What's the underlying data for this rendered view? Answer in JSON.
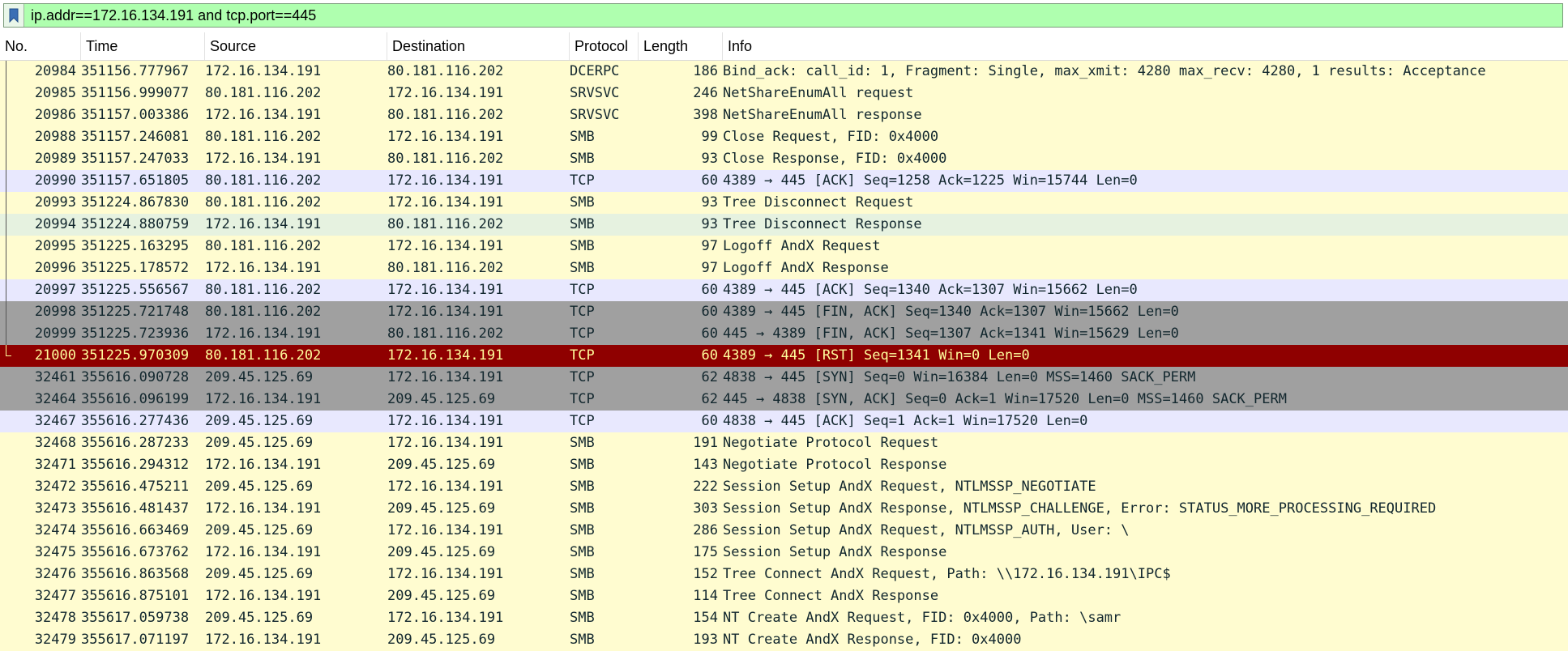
{
  "filter": {
    "value": "ip.addr==172.16.134.191 and tcp.port==445",
    "bookmark_icon": "bookmark-icon"
  },
  "columns": [
    {
      "label": "No."
    },
    {
      "label": "Time"
    },
    {
      "label": "Source"
    },
    {
      "label": "Destination"
    },
    {
      "label": "Protocol"
    },
    {
      "label": "Length"
    },
    {
      "label": "Info"
    }
  ],
  "colors": {
    "filter_bg": "#afffaf",
    "smb_row": "#fffcd0",
    "tcp_row": "#e8e8fe",
    "tcp_flag_row": "#a0a0a0",
    "selected_row": "#8f0000",
    "selected_text": "#fffc9c"
  },
  "packets": [
    {
      "no": "20984",
      "time": "351156.777967",
      "src": "172.16.134.191",
      "dst": "80.181.116.202",
      "proto": "DCERPC",
      "len": "186",
      "info": "Bind_ack: call_id: 1, Fragment: Single, max_xmit: 4280 max_recv: 4280, 1 results: Acceptance",
      "style": "smb",
      "tree": "line"
    },
    {
      "no": "20985",
      "time": "351156.999077",
      "src": "80.181.116.202",
      "dst": "172.16.134.191",
      "proto": "SRVSVC",
      "len": "246",
      "info": "NetShareEnumAll request",
      "style": "smb",
      "tree": "line"
    },
    {
      "no": "20986",
      "time": "351157.003386",
      "src": "172.16.134.191",
      "dst": "80.181.116.202",
      "proto": "SRVSVC",
      "len": "398",
      "info": "NetShareEnumAll response",
      "style": "smb",
      "tree": "line"
    },
    {
      "no": "20988",
      "time": "351157.246081",
      "src": "80.181.116.202",
      "dst": "172.16.134.191",
      "proto": "SMB",
      "len": "99",
      "info": "Close Request, FID: 0x4000",
      "style": "smb",
      "tree": "line"
    },
    {
      "no": "20989",
      "time": "351157.247033",
      "src": "172.16.134.191",
      "dst": "80.181.116.202",
      "proto": "SMB",
      "len": "93",
      "info": "Close Response, FID: 0x4000",
      "style": "smb",
      "tree": "line"
    },
    {
      "no": "20990",
      "time": "351157.651805",
      "src": "80.181.116.202",
      "dst": "172.16.134.191",
      "proto": "TCP",
      "len": "60",
      "info": "4389 → 445 [ACK] Seq=1258 Ack=1225 Win=15744 Len=0",
      "style": "tcp",
      "tree": "line"
    },
    {
      "no": "20993",
      "time": "351224.867830",
      "src": "80.181.116.202",
      "dst": "172.16.134.191",
      "proto": "SMB",
      "len": "93",
      "info": "Tree Disconnect Request",
      "style": "smb",
      "tree": "line"
    },
    {
      "no": "20994",
      "time": "351224.880759",
      "src": "172.16.134.191",
      "dst": "80.181.116.202",
      "proto": "SMB",
      "len": "93",
      "info": "Tree Disconnect Response",
      "style": "altgreen",
      "tree": "line"
    },
    {
      "no": "20995",
      "time": "351225.163295",
      "src": "80.181.116.202",
      "dst": "172.16.134.191",
      "proto": "SMB",
      "len": "97",
      "info": "Logoff AndX Request",
      "style": "smb",
      "tree": "line"
    },
    {
      "no": "20996",
      "time": "351225.178572",
      "src": "172.16.134.191",
      "dst": "80.181.116.202",
      "proto": "SMB",
      "len": "97",
      "info": "Logoff AndX Response",
      "style": "smb",
      "tree": "line"
    },
    {
      "no": "20997",
      "time": "351225.556567",
      "src": "80.181.116.202",
      "dst": "172.16.134.191",
      "proto": "TCP",
      "len": "60",
      "info": "4389 → 445 [ACK] Seq=1340 Ack=1307 Win=15662 Len=0",
      "style": "tcp",
      "tree": "line"
    },
    {
      "no": "20998",
      "time": "351225.721748",
      "src": "80.181.116.202",
      "dst": "172.16.134.191",
      "proto": "TCP",
      "len": "60",
      "info": "4389 → 445 [FIN, ACK] Seq=1340 Ack=1307 Win=15662 Len=0",
      "style": "tcpgray",
      "tree": "line"
    },
    {
      "no": "20999",
      "time": "351225.723936",
      "src": "172.16.134.191",
      "dst": "80.181.116.202",
      "proto": "TCP",
      "len": "60",
      "info": "445 → 4389 [FIN, ACK] Seq=1307 Ack=1341 Win=15629 Len=0",
      "style": "tcpgray",
      "tree": "line"
    },
    {
      "no": "21000",
      "time": "351225.970309",
      "src": "80.181.116.202",
      "dst": "172.16.134.191",
      "proto": "TCP",
      "len": "60",
      "info": "4389 → 445 [RST] Seq=1341 Win=0 Len=0",
      "style": "selected",
      "tree": "end"
    },
    {
      "no": "32461",
      "time": "355616.090728",
      "src": "209.45.125.69",
      "dst": "172.16.134.191",
      "proto": "TCP",
      "len": "62",
      "info": "4838 → 445 [SYN] Seq=0 Win=16384 Len=0 MSS=1460 SACK_PERM",
      "style": "tcpsyn",
      "tree": "none"
    },
    {
      "no": "32464",
      "time": "355616.096199",
      "src": "172.16.134.191",
      "dst": "209.45.125.69",
      "proto": "TCP",
      "len": "62",
      "info": "445 → 4838 [SYN, ACK] Seq=0 Ack=1 Win=17520 Len=0 MSS=1460 SACK_PERM",
      "style": "tcpsyn",
      "tree": "none"
    },
    {
      "no": "32467",
      "time": "355616.277436",
      "src": "209.45.125.69",
      "dst": "172.16.134.191",
      "proto": "TCP",
      "len": "60",
      "info": "4838 → 445 [ACK] Seq=1 Ack=1 Win=17520 Len=0",
      "style": "tcp",
      "tree": "none"
    },
    {
      "no": "32468",
      "time": "355616.287233",
      "src": "209.45.125.69",
      "dst": "172.16.134.191",
      "proto": "SMB",
      "len": "191",
      "info": "Negotiate Protocol Request",
      "style": "smb",
      "tree": "none"
    },
    {
      "no": "32471",
      "time": "355616.294312",
      "src": "172.16.134.191",
      "dst": "209.45.125.69",
      "proto": "SMB",
      "len": "143",
      "info": "Negotiate Protocol Response",
      "style": "smb",
      "tree": "none"
    },
    {
      "no": "32472",
      "time": "355616.475211",
      "src": "209.45.125.69",
      "dst": "172.16.134.191",
      "proto": "SMB",
      "len": "222",
      "info": "Session Setup AndX Request, NTLMSSP_NEGOTIATE",
      "style": "smb",
      "tree": "none"
    },
    {
      "no": "32473",
      "time": "355616.481437",
      "src": "172.16.134.191",
      "dst": "209.45.125.69",
      "proto": "SMB",
      "len": "303",
      "info": "Session Setup AndX Response, NTLMSSP_CHALLENGE, Error: STATUS_MORE_PROCESSING_REQUIRED",
      "style": "smb",
      "tree": "none"
    },
    {
      "no": "32474",
      "time": "355616.663469",
      "src": "209.45.125.69",
      "dst": "172.16.134.191",
      "proto": "SMB",
      "len": "286",
      "info": "Session Setup AndX Request, NTLMSSP_AUTH, User: \\",
      "style": "smb",
      "tree": "none"
    },
    {
      "no": "32475",
      "time": "355616.673762",
      "src": "172.16.134.191",
      "dst": "209.45.125.69",
      "proto": "SMB",
      "len": "175",
      "info": "Session Setup AndX Response",
      "style": "smb",
      "tree": "none"
    },
    {
      "no": "32476",
      "time": "355616.863568",
      "src": "209.45.125.69",
      "dst": "172.16.134.191",
      "proto": "SMB",
      "len": "152",
      "info": "Tree Connect AndX Request, Path: \\\\172.16.134.191\\IPC$",
      "style": "smb",
      "tree": "none"
    },
    {
      "no": "32477",
      "time": "355616.875101",
      "src": "172.16.134.191",
      "dst": "209.45.125.69",
      "proto": "SMB",
      "len": "114",
      "info": "Tree Connect AndX Response",
      "style": "smb",
      "tree": "none"
    },
    {
      "no": "32478",
      "time": "355617.059738",
      "src": "209.45.125.69",
      "dst": "172.16.134.191",
      "proto": "SMB",
      "len": "154",
      "info": "NT Create AndX Request, FID: 0x4000, Path: \\samr",
      "style": "smb",
      "tree": "none"
    },
    {
      "no": "32479",
      "time": "355617.071197",
      "src": "172.16.134.191",
      "dst": "209.45.125.69",
      "proto": "SMB",
      "len": "193",
      "info": "NT Create AndX Response, FID: 0x4000",
      "style": "smb",
      "tree": "none"
    }
  ]
}
